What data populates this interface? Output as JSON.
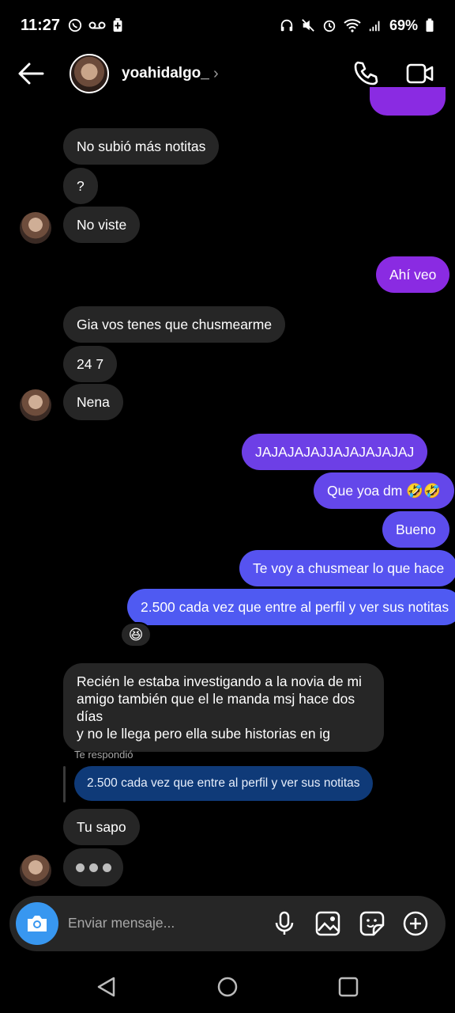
{
  "status": {
    "time": "11:27",
    "battery": "69%"
  },
  "header": {
    "username": "yoahidalgo_",
    "chevron": "›"
  },
  "messages": {
    "m1": "No subió más notitas",
    "m2": "?",
    "m3": "No viste",
    "m4": "Ahí veo",
    "m5": "Gia vos tenes que chusmearme",
    "m6": "24 7",
    "m7": "Nena",
    "m8": "JAJAJAJAJJAJAJAJAJAJ",
    "m9": "Que yoa dm 🤣🤣",
    "m10": "Bueno",
    "m11": "Te voy a chusmear lo que hace",
    "m12": "2.500 cada vez que entre al perfil y ver sus notitas",
    "reaction": "😆",
    "m13_l1": "Recién le estaba investigando a la novia de mi",
    "m13_l2": "amigo también que el le manda msj hace dos días",
    "m13_l3": "y no le llega pero ella sube historias en ig",
    "replied_label": "Te respondió",
    "reply_quote": "2.500 cada vez que entre al perfil y ver sus notitas",
    "m14": "Tu sapo"
  },
  "composer": {
    "placeholder": "Enviar mensaje..."
  },
  "colors": {
    "incoming": "#262626",
    "out_purple": "#8a2be2",
    "out_indigo": "#5b51f0",
    "camera": "#3897f0",
    "reply": "#0f3a78"
  },
  "icons": [
    "whatsapp-icon",
    "voicemail-icon",
    "battery-saver-icon",
    "headphones-icon",
    "mute-icon",
    "alarm-icon",
    "wifi-icon",
    "signal-icon",
    "battery-icon",
    "back-arrow-icon",
    "phone-icon",
    "video-icon",
    "camera-icon",
    "microphone-icon",
    "gallery-icon",
    "sticker-icon",
    "plus-icon",
    "nav-back-icon",
    "nav-home-icon",
    "nav-recents-icon"
  ]
}
